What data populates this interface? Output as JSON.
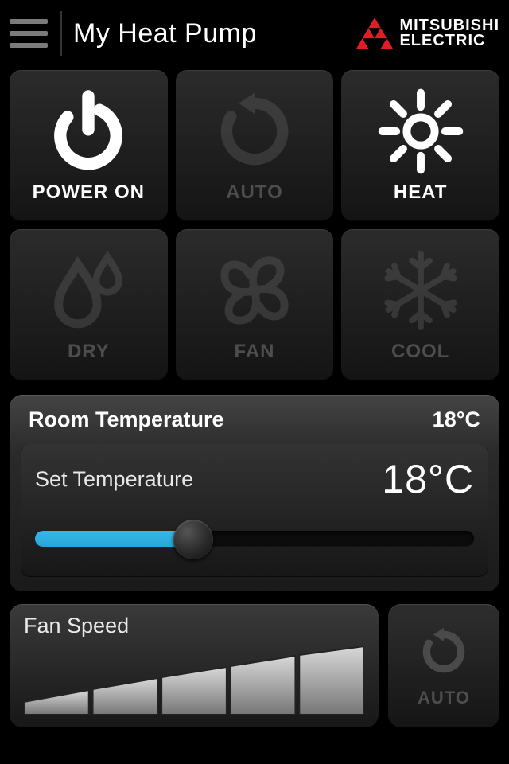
{
  "header": {
    "title": "My Heat Pump",
    "brand_line1": "MITSUBISHI",
    "brand_line2": "ELECTRIC"
  },
  "modes": {
    "power": {
      "label": "POWER ON",
      "active": true
    },
    "auto": {
      "label": "AUTO",
      "active": false
    },
    "heat": {
      "label": "HEAT",
      "active": true
    },
    "dry": {
      "label": "DRY",
      "active": false
    },
    "fan": {
      "label": "FAN",
      "active": false
    },
    "cool": {
      "label": "COOL",
      "active": false
    }
  },
  "temperature": {
    "room_label": "Room Temperature",
    "room_value": "18°C",
    "set_label": "Set Temperature",
    "set_value": "18°C",
    "slider_percent": 36
  },
  "fan": {
    "label": "Fan Speed",
    "auto_label": "AUTO"
  },
  "colors": {
    "accent": "#2fb4e4",
    "brand_red": "#e21c24"
  }
}
